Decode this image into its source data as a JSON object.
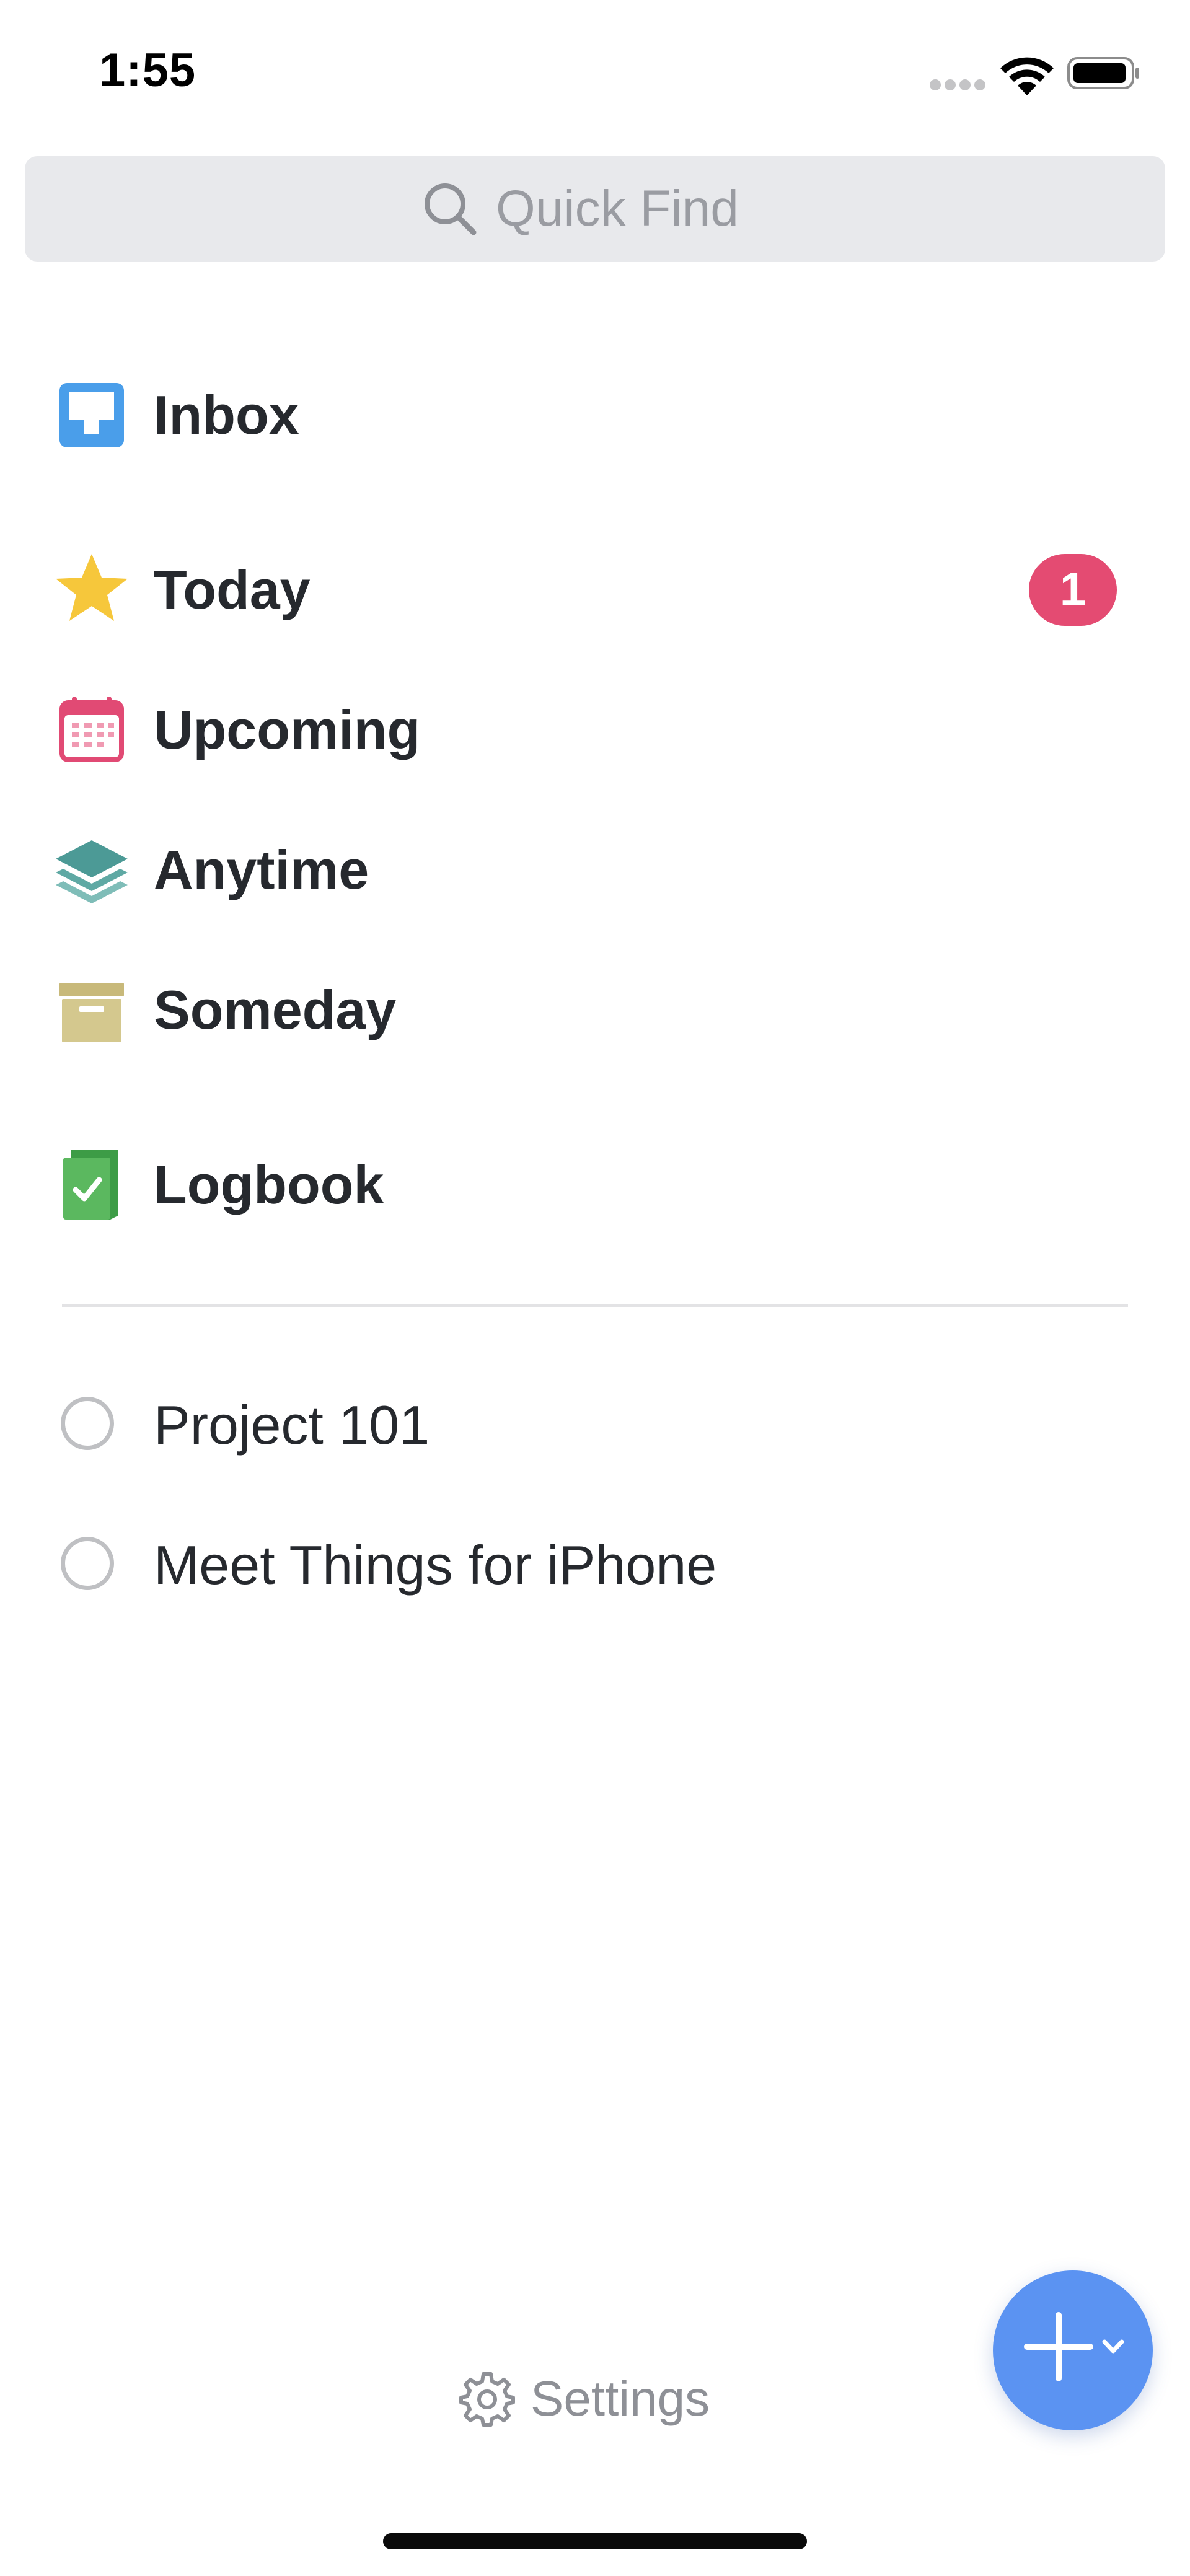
{
  "status_bar": {
    "time": "1:55"
  },
  "search": {
    "placeholder": "Quick Find"
  },
  "nav": {
    "items": [
      {
        "id": "inbox",
        "label": "Inbox",
        "icon": "inbox-icon",
        "color": "#4a9eea"
      },
      {
        "id": "today",
        "label": "Today",
        "icon": "star-icon",
        "color": "#f6c73b",
        "badge": "1",
        "badge_color": "#e44b72"
      },
      {
        "id": "upcoming",
        "label": "Upcoming",
        "icon": "calendar-icon",
        "color": "#e14a74"
      },
      {
        "id": "anytime",
        "label": "Anytime",
        "icon": "layers-icon",
        "color": "#4c9a96"
      },
      {
        "id": "someday",
        "label": "Someday",
        "icon": "archive-box-icon",
        "color": "#c8b97a"
      },
      {
        "id": "logbook",
        "label": "Logbook",
        "icon": "logbook-check-icon",
        "color": "#5bb85f"
      }
    ]
  },
  "projects": [
    {
      "label": "Project 101",
      "icon": "project-circle-icon"
    },
    {
      "label": "Meet Things for iPhone",
      "icon": "project-circle-icon"
    }
  ],
  "footer": {
    "settings_label": "Settings",
    "settings_icon": "gear-icon"
  },
  "fab": {
    "icon": "plus-icon",
    "secondary_icon": "chevron-down-icon",
    "color": "#5b93f2"
  }
}
